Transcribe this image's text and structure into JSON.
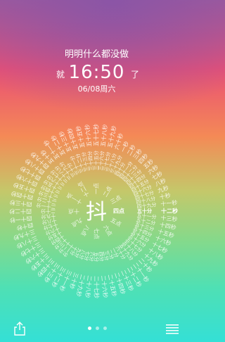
{
  "header": {
    "headline": "明明什么都没做",
    "left_word": "就",
    "time": "16:50",
    "right_word": "了",
    "date": "06/08周六"
  },
  "dial": {
    "center_char": "抖",
    "hour_label": "四点",
    "minute_label": "五十分",
    "second_label": "十二秒",
    "hours": [
      "一点",
      "二点",
      "三点",
      "四点",
      "五点",
      "六点",
      "七点",
      "八点",
      "九点",
      "十点",
      "十一点",
      "十二点"
    ],
    "minutes": [
      "一分",
      "二分",
      "三分",
      "四分",
      "五分",
      "六分",
      "七分",
      "八分",
      "九分",
      "十分",
      "十一分",
      "十二分",
      "十三分",
      "十四分",
      "十五分",
      "十六分",
      "十七分",
      "十八分",
      "十九分",
      "二十分",
      "二十一分",
      "二十二分",
      "二十三分",
      "二十四分",
      "二十五分",
      "二十六分",
      "二十七分",
      "二十八分",
      "二十九分",
      "三十分",
      "三十一分",
      "三十二分",
      "三十三分",
      "三十四分",
      "三十五分",
      "三十六分",
      "三十七分",
      "三十八分",
      "三十九分",
      "四十分",
      "四十一分",
      "四十二分",
      "四十三分",
      "四十四分",
      "四十五分",
      "四十六分",
      "四十七分",
      "四十八分",
      "四十九分",
      "五十分",
      "五十一分",
      "五十二分",
      "五十三分",
      "五十四分",
      "五十五分",
      "五十六分",
      "五十七分",
      "五十八分",
      "五十九分",
      "六十分"
    ],
    "seconds": [
      "一秒",
      "二秒",
      "三秒",
      "四秒",
      "五秒",
      "六秒",
      "七秒",
      "八秒",
      "九秒",
      "十秒",
      "十一秒",
      "十二秒",
      "十三秒",
      "十四秒",
      "十五秒",
      "十六秒",
      "十七秒",
      "十八秒",
      "十九秒",
      "二十秒",
      "二十一秒",
      "二十二秒",
      "二十三秒",
      "二十四秒",
      "二十五秒",
      "二十六秒",
      "二十七秒",
      "二十八秒",
      "二十九秒",
      "三十秒",
      "三十一秒",
      "三十二秒",
      "三十三秒",
      "三十四秒",
      "三十五秒",
      "三十六秒",
      "三十七秒",
      "三十八秒",
      "三十九秒",
      "四十秒",
      "四十一秒",
      "四十二秒",
      "四十三秒",
      "四十四秒",
      "四十五秒",
      "四十六秒",
      "四十七秒",
      "四十八秒",
      "四十九秒",
      "五十秒",
      "五十一秒",
      "五十二秒",
      "五十三秒",
      "五十四秒",
      "五十五秒",
      "五十六秒",
      "五十七秒",
      "五十八秒",
      "五十九秒",
      "六十秒"
    ]
  },
  "bottom_bar": {
    "share_icon": "share-icon",
    "menu_icon": "menu-icon",
    "page_dots": 3,
    "active_dot": 0
  }
}
